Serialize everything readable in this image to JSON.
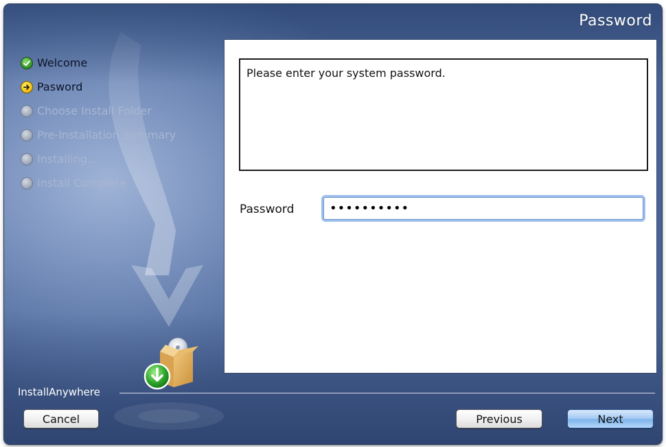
{
  "window": {
    "title": "Password"
  },
  "steps": [
    {
      "label": "Welcome",
      "state": "done"
    },
    {
      "label": "Pasword",
      "state": "current"
    },
    {
      "label": "Choose Install Folder",
      "state": "pending"
    },
    {
      "label": "Pre-Installation Summary",
      "state": "pending"
    },
    {
      "label": "Installing...",
      "state": "pending"
    },
    {
      "label": "Install Complete",
      "state": "pending"
    }
  ],
  "content": {
    "message": "Please enter your system password.",
    "password_label": "Password",
    "password_value": "••••••••••"
  },
  "footer": {
    "brand": "InstallAnywhere",
    "cancel_label": "Cancel",
    "previous_label": "Previous",
    "next_label": "Next"
  },
  "colors": {
    "background_blue": "#6f88b8",
    "default_button": "#8fbff0",
    "focus_ring": "#9ec0ec"
  },
  "icons": {
    "done": "checkmark-circle-icon",
    "current": "arrow-right-circle-icon",
    "pending": "gray-circle-icon",
    "installer": "installer-box-icon"
  }
}
